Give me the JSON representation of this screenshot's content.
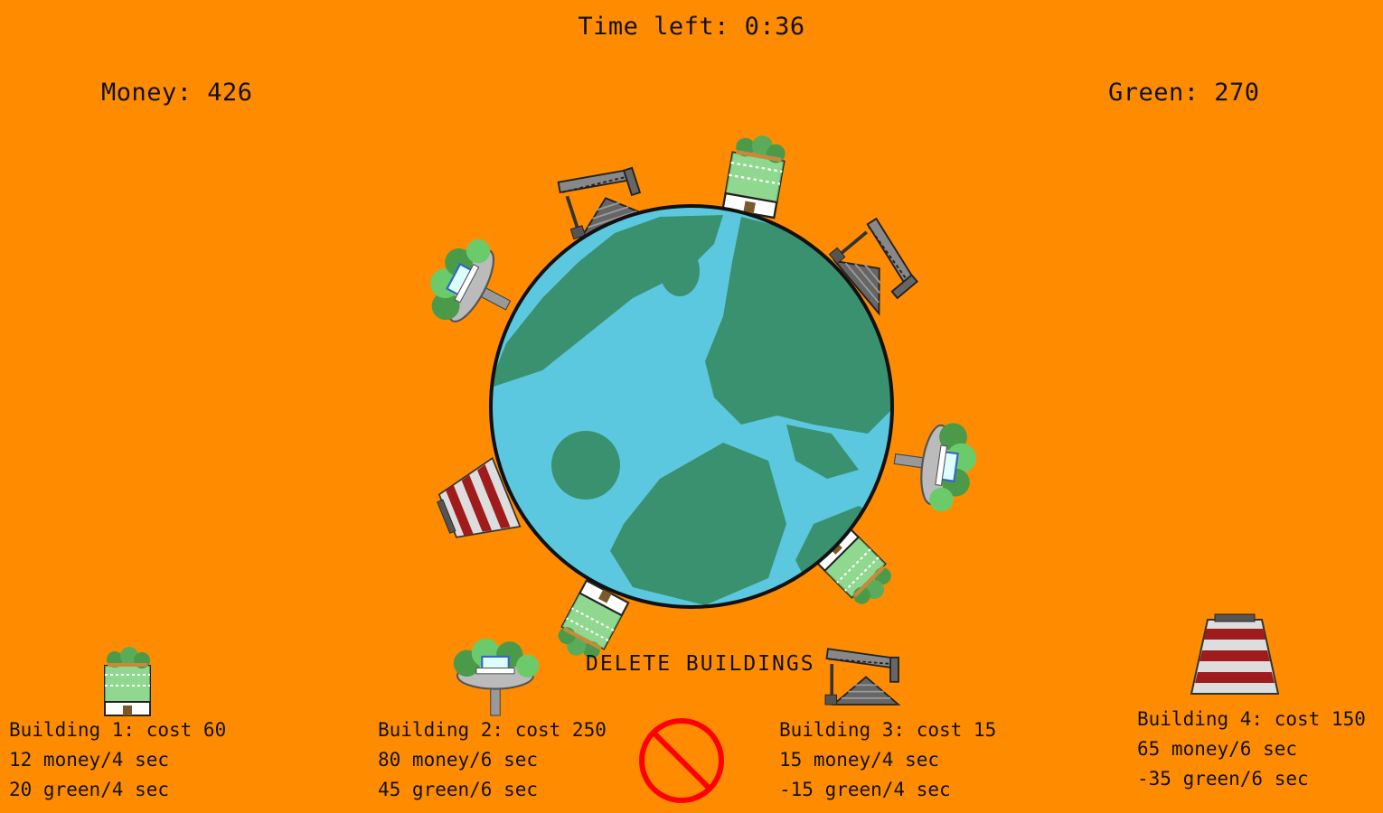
{
  "hud": {
    "timer": "Time left: 0:36",
    "money": "Money: 426",
    "green": "Green: 270"
  },
  "colors": {
    "background": "#ff8c00",
    "ocean": "#5bc8e0",
    "land": "#3a9170",
    "roof_green": "#6bcb6b",
    "tree": "#4a9a4a",
    "stripe_red": "#a01c1c",
    "delete_red": "#ff0000"
  },
  "buildings": [
    {
      "icon": "eco-house-icon",
      "name": "Building 1: cost 60",
      "money": "12 money/4 sec",
      "green": "20 green/4 sec"
    },
    {
      "icon": "garden-dish-icon",
      "name": "Building 2: cost 250",
      "money": "80 money/6 sec",
      "green": "45 green/6 sec"
    },
    {
      "icon": "oil-pump-icon",
      "name": "Building 3: cost 15",
      "money": "15 money/4 sec",
      "green": "-15 green/4 sec"
    },
    {
      "icon": "factory-icon",
      "name": "Building 4: cost 150",
      "money": "65 money/6 sec",
      "green": "-35 green/6 sec"
    }
  ],
  "delete": {
    "label": "DELETE BUILDINGS",
    "icon": "no-entry-icon"
  }
}
